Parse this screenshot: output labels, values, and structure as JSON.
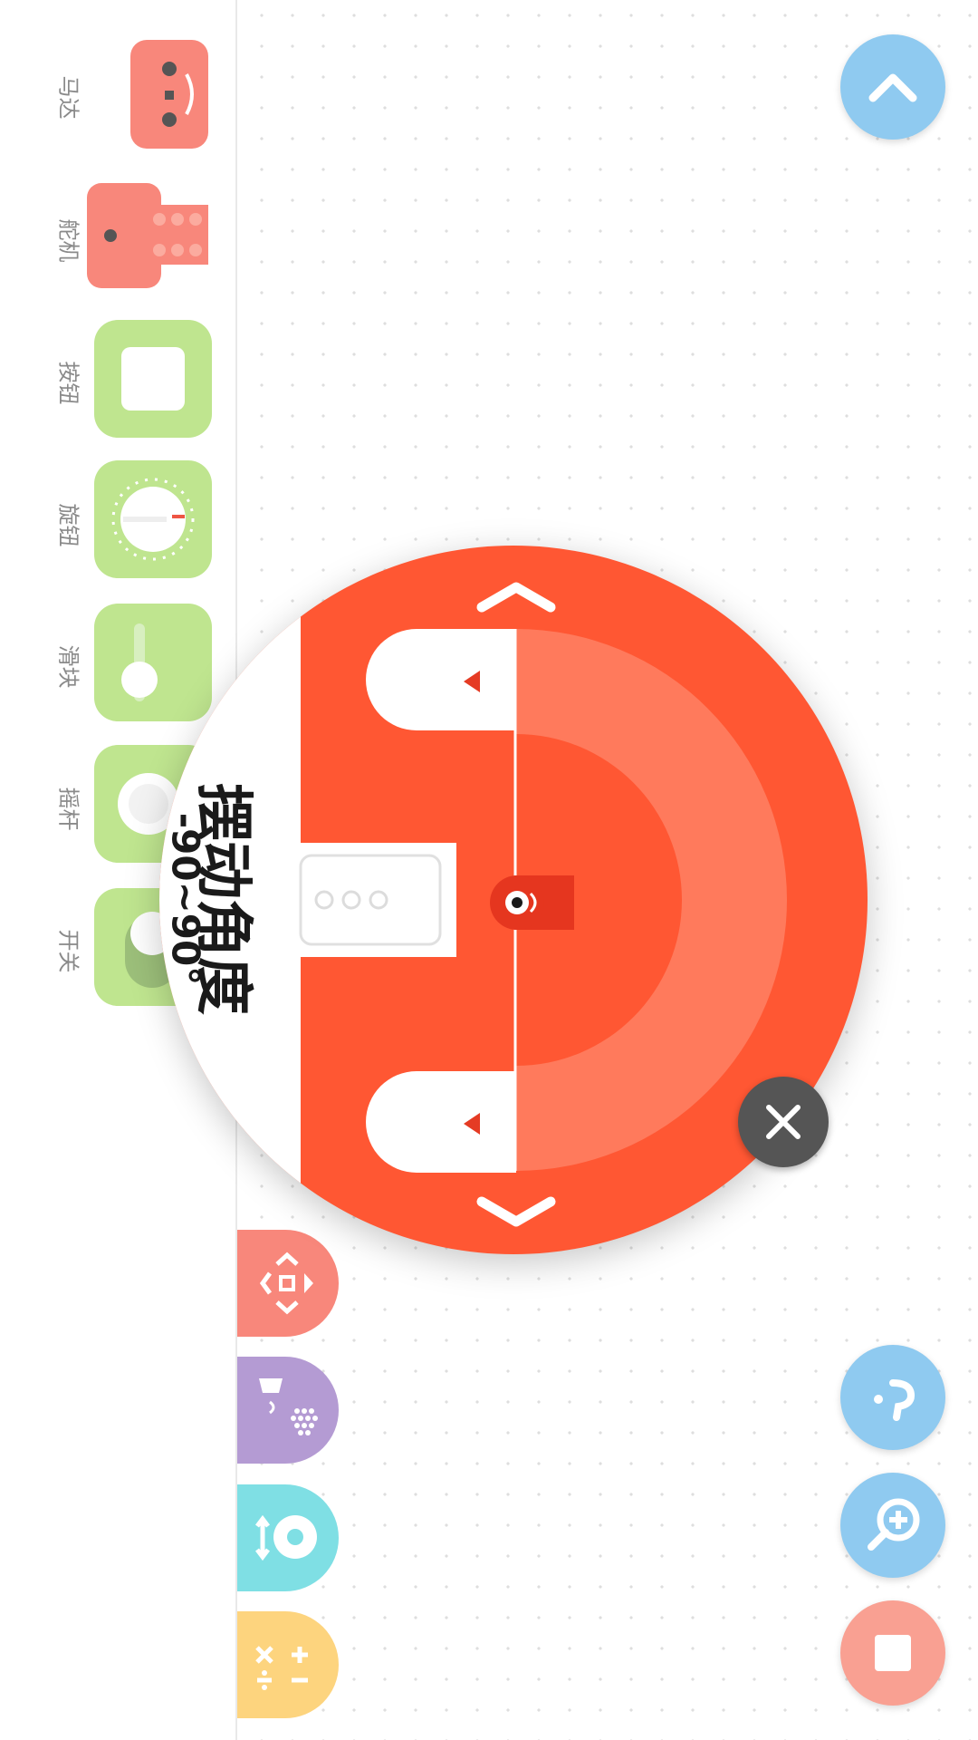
{
  "sidebar": {
    "items": [
      {
        "label": "马达",
        "icon": "motor-icon"
      },
      {
        "label": "舵机",
        "icon": "servo-icon"
      },
      {
        "label": "按钮",
        "icon": "button-icon"
      },
      {
        "label": "旋钮",
        "icon": "knob-icon"
      },
      {
        "label": "滑块",
        "icon": "slider-icon"
      },
      {
        "label": "摇杆",
        "icon": "joystick-icon"
      },
      {
        "label": "开关",
        "icon": "switch-icon"
      }
    ]
  },
  "categories": [
    {
      "icon": "move-icon",
      "color": "#f8877b"
    },
    {
      "icon": "display-sound-icon",
      "color": "#b49bd3"
    },
    {
      "icon": "sensor-icon",
      "color": "#7fdfe4"
    },
    {
      "icon": "math-operators-icon",
      "color": "#fdd47e"
    }
  ],
  "popup": {
    "title": "摆动角度",
    "range": "-90~90°",
    "accent": "#ff5733",
    "arc_color": "#ff7a5c"
  },
  "fabs": [
    {
      "name": "collapse-button",
      "icon": "chevron-up-icon"
    },
    {
      "name": "help-button",
      "icon": "help-icon"
    },
    {
      "name": "zoom-button",
      "icon": "zoom-in-icon"
    },
    {
      "name": "stop-button",
      "icon": "stop-icon"
    }
  ],
  "colors": {
    "fab_blue": "#8fcaf0",
    "stop_red": "#f9a092",
    "tile_green": "#bfe58f",
    "tile_red": "#f8877b"
  }
}
